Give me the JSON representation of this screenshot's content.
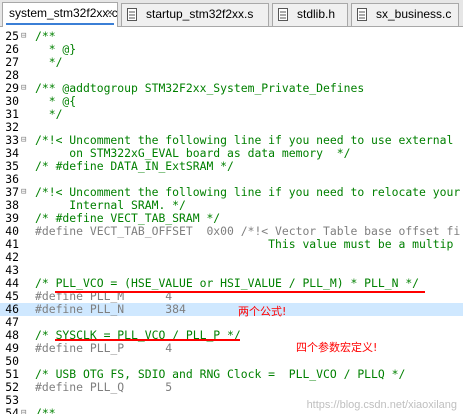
{
  "tabs": [
    {
      "label": "system_stm32f2xx.c",
      "close": "×",
      "active": true,
      "icon": false
    },
    {
      "label": "startup_stm32f2xx.s",
      "active": false,
      "icon": true
    },
    {
      "label": "stdlib.h",
      "active": false,
      "icon": true
    },
    {
      "label": "sx_business.c",
      "active": false,
      "icon": true
    }
  ],
  "lines": [
    {
      "n": "25",
      "text": "/**"
    },
    {
      "n": "26",
      "text": "  * @}"
    },
    {
      "n": "27",
      "text": "  */"
    },
    {
      "n": "28",
      "text": ""
    },
    {
      "n": "29",
      "text": "/** @addtogroup STM32F2xx_System_Private_Defines"
    },
    {
      "n": "30",
      "text": "  * @{"
    },
    {
      "n": "31",
      "text": "  */"
    },
    {
      "n": "32",
      "text": ""
    },
    {
      "n": "33",
      "text": "/*!< Uncomment the following line if you need to use external"
    },
    {
      "n": "34",
      "text": "     on STM322xG_EVAL board as data memory  */"
    },
    {
      "n": "35",
      "text": "/* #define DATA_IN_ExtSRAM */"
    },
    {
      "n": "36",
      "text": ""
    },
    {
      "n": "37",
      "text": "/*!< Uncomment the following line if you need to relocate your"
    },
    {
      "n": "38",
      "text": "     Internal SRAM. */"
    },
    {
      "n": "39",
      "text": "/* #define VECT_TAB_SRAM */"
    },
    {
      "n": "40",
      "text": "#define VECT_TAB_OFFSET  0x00 /*!< Vector Table base offset fi"
    },
    {
      "n": "41",
      "text": "                                  This value must be a multip"
    },
    {
      "n": "42",
      "text": ""
    },
    {
      "n": "43",
      "text": ""
    },
    {
      "n": "44",
      "text": "/* PLL_VCO = (HSE_VALUE or HSI_VALUE / PLL_M) * PLL_N */"
    },
    {
      "n": "45",
      "text": "#define PLL_M      4"
    },
    {
      "n": "46",
      "text": "#define PLL_N      384"
    },
    {
      "n": "47",
      "text": ""
    },
    {
      "n": "48",
      "text": "/* SYSCLK = PLL_VCO / PLL_P */"
    },
    {
      "n": "49",
      "text": "#define PLL_P      4"
    },
    {
      "n": "50",
      "text": ""
    },
    {
      "n": "51",
      "text": "/* USB OTG FS, SDIO and RNG Clock =  PLL_VCO / PLLQ */"
    },
    {
      "n": "52",
      "text": "#define PLL_Q      5"
    },
    {
      "n": "53",
      "text": ""
    },
    {
      "n": "54",
      "text": "/**"
    }
  ],
  "annotations": {
    "formulas_note": "两个公式!",
    "params_note": "四个参数宏定义!"
  },
  "watermark": "https://blog.csdn.net/xiaoxilang",
  "colors": {
    "comment": "#008000",
    "preprocessor": "#7f7f7f",
    "annotation": "#ff0000",
    "tab_accent": "#3b7fd6"
  }
}
